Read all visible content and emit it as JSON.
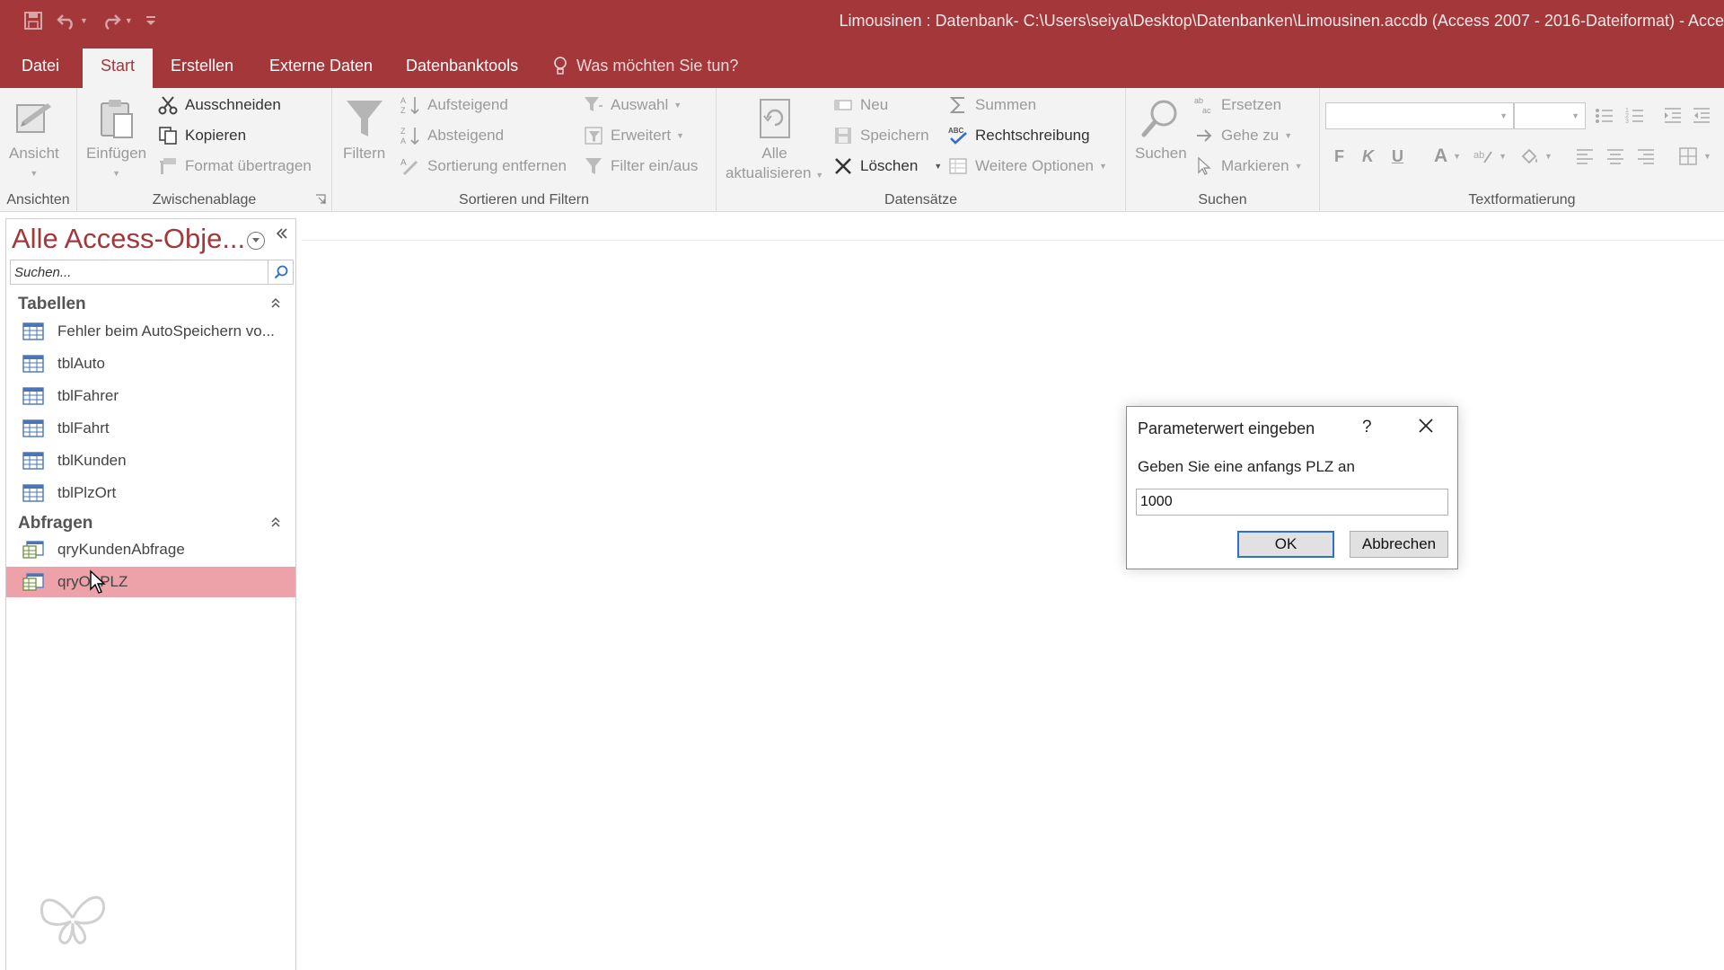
{
  "window": {
    "title": "Limousinen : Datenbank- C:\\Users\\seiya\\Desktop\\Datenbanken\\Limousinen.accdb (Access 2007 - 2016-Dateiformat)  -  Acce"
  },
  "quick_access": {
    "icons": [
      "save-icon",
      "undo-icon",
      "redo-icon",
      "customize-icon"
    ]
  },
  "tabs": [
    {
      "label": "Datei"
    },
    {
      "label": "Start"
    },
    {
      "label": "Erstellen"
    },
    {
      "label": "Externe Daten"
    },
    {
      "label": "Datenbanktools"
    }
  ],
  "tell_me": "Was möchten Sie tun?",
  "ribbon": {
    "ansichten": {
      "label": "Ansichten",
      "ansicht": "Ansicht"
    },
    "zwischenablage": {
      "label": "Zwischenablage",
      "einfuegen": "Einfügen",
      "ausschneiden": "Ausschneiden",
      "kopieren": "Kopieren",
      "format": "Format übertragen"
    },
    "sortieren": {
      "label": "Sortieren und Filtern",
      "filtern": "Filtern",
      "aufsteigend": "Aufsteigend",
      "absteigend": "Absteigend",
      "sortierung_entfernen": "Sortierung entfernen",
      "auswahl": "Auswahl",
      "erweitert": "Erweitert",
      "filter_einaus": "Filter ein/aus"
    },
    "datensaetze": {
      "label": "Datensätze",
      "alle": "Alle",
      "aktualisieren": "aktualisieren",
      "neu": "Neu",
      "speichern": "Speichern",
      "loeschen": "Löschen",
      "summen": "Summen",
      "rechtschreibung": "Rechtschreibung",
      "weitere": "Weitere Optionen"
    },
    "suchen": {
      "label": "Suchen",
      "suchen": "Suchen",
      "ersetzen": "Ersetzen",
      "gehe_zu": "Gehe zu",
      "markieren": "Markieren"
    },
    "textformat": {
      "label": "Textformatierung",
      "bold": "F",
      "italic": "K",
      "underline": "U",
      "font_color": "A"
    }
  },
  "nav": {
    "title": "Alle Access-Obje...",
    "search_placeholder": "Suchen...",
    "sections": [
      {
        "label": "Tabellen",
        "items": [
          {
            "label": "Fehler beim AutoSpeichern vo..."
          },
          {
            "label": "tblAuto"
          },
          {
            "label": "tblFahrer"
          },
          {
            "label": "tblFahrt"
          },
          {
            "label": "tblKunden"
          },
          {
            "label": "tblPlzOrt"
          }
        ]
      },
      {
        "label": "Abfragen",
        "items": [
          {
            "label": "qryKundenAbfrage"
          },
          {
            "label": "qryOrtPLZ",
            "selected": true
          }
        ]
      }
    ]
  },
  "dialog": {
    "title": "Parameterwert eingeben",
    "help": "?",
    "prompt": "Geben Sie eine anfangs PLZ an",
    "value": "1000",
    "ok": "OK",
    "cancel": "Abbrechen"
  },
  "colors": {
    "brand": "#a4373a",
    "selection": "#eda1a8",
    "default_button_border": "#2e6fd1"
  }
}
